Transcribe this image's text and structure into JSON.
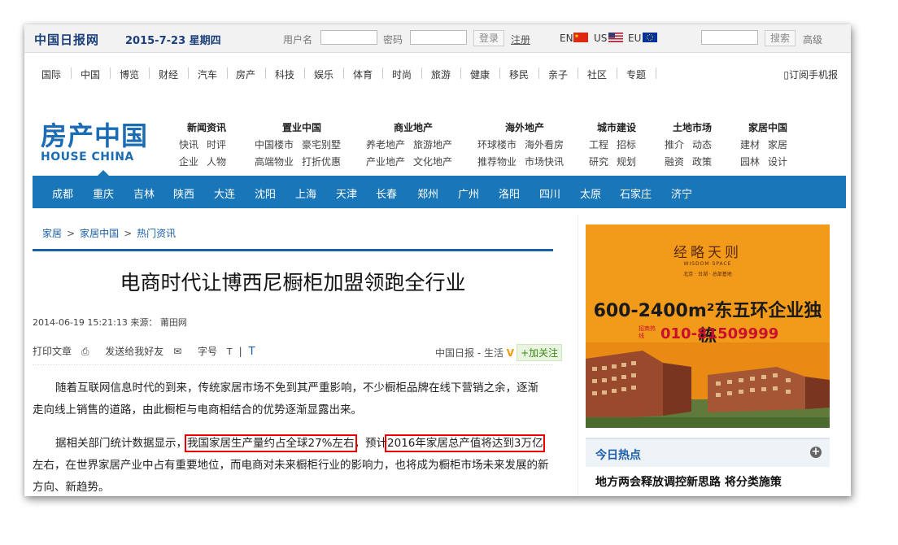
{
  "topbar": {
    "logo": "中国日报网",
    "date": "2015-7-23 星期四",
    "username_label": "用户名",
    "password_label": "密码",
    "login_label": "登录",
    "register_label": "注册",
    "lang_en": "EN",
    "lang_us": "US",
    "lang_eu": "EU",
    "search_label": "搜索",
    "advanced_label": "高级"
  },
  "nav": {
    "items": [
      "国际",
      "中国",
      "博览",
      "财经",
      "汽车",
      "房产",
      "科技",
      "娱乐",
      "体育",
      "时尚",
      "旅游",
      "健康",
      "移民",
      "亲子",
      "社区",
      "专题"
    ],
    "subscribe": "订阅手机报"
  },
  "house_china": {
    "logo_cn": "房产中国",
    "logo_en": "HOUSE CHINA",
    "categories": [
      {
        "head": "新闻资讯",
        "row1": [
          "快讯",
          "时评"
        ],
        "row2": [
          "企业",
          "人物"
        ]
      },
      {
        "head": "置业中国",
        "row1": [
          "中国楼市",
          "豪宅别墅"
        ],
        "row2": [
          "高端物业",
          "打折优惠"
        ]
      },
      {
        "head": "商业地产",
        "row1": [
          "养老地产",
          "旅游地产"
        ],
        "row2": [
          "产业地产",
          "文化地产"
        ]
      },
      {
        "head": "海外地产",
        "row1": [
          "环球楼市",
          "海外看房"
        ],
        "row2": [
          "推荐物业",
          "市场快讯"
        ]
      },
      {
        "head": "城市建设",
        "row1": [
          "工程",
          "招标"
        ],
        "row2": [
          "研究",
          "规划"
        ]
      },
      {
        "head": "土地市场",
        "row1": [
          "推介",
          "动态"
        ],
        "row2": [
          "融资",
          "政策"
        ]
      },
      {
        "head": "家居中国",
        "row1": [
          "建材",
          "家居"
        ],
        "row2": [
          "园林",
          "设计"
        ]
      }
    ]
  },
  "cities": [
    "成都",
    "重庆",
    "吉林",
    "陕西",
    "大连",
    "沈阳",
    "上海",
    "天津",
    "长春",
    "郑州",
    "广州",
    "洛阳",
    "四川",
    "太原",
    "石家庄",
    "济宁"
  ],
  "breadcrumb": {
    "a": "家居",
    "b": "家居中国",
    "c": "热门资讯",
    "sep": ">"
  },
  "article": {
    "title": "电商时代让博西尼橱柜加盟领跑全行业",
    "meta": "2014-06-19 15:21:13 来源： 莆田网",
    "print": "打印文章",
    "send": "发送给我好友",
    "fontsize": "字号",
    "font_t_small": "T",
    "font_sep": "|",
    "font_t_large": "T",
    "source_right": "中国日报 - 生活",
    "follow": "+加关注",
    "p1": "随着互联网信息时代的到来，传统家居市场不免到其严重影响，不少橱柜品牌在线下营销之余，逐渐走向线上销售的道路，由此橱柜与电商相结合的优势逐渐显露出来。",
    "p2_a": "据相关部门统计数据显示，",
    "p2_h1": "我国家居生产量约占全球27%左右",
    "p2_b": "，预计",
    "p2_h2": "2016年家居总产值将达到3万亿",
    "p2_c": "左右，在世界家居产业中占有重要地位，而电商对未来橱柜行业的影响力，也将成为橱柜市场未来发展的新方向、新趋势。"
  },
  "ad": {
    "brand": "经略天则",
    "brand_en": "WISDOM SPACE",
    "brand_sub": "北京 · 台湖 · 总部基地",
    "slogan": "600-2400m²东五环企业独栋",
    "phone_label": "招商热线",
    "phone": "010-81509999",
    "color": "#f29a1a"
  },
  "hot": {
    "title": "今日热点",
    "item1": "地方两会释放调控新思路 将分类施策"
  },
  "colors": {
    "brand_blue": "#1976b8",
    "highlight": "#e00000"
  }
}
